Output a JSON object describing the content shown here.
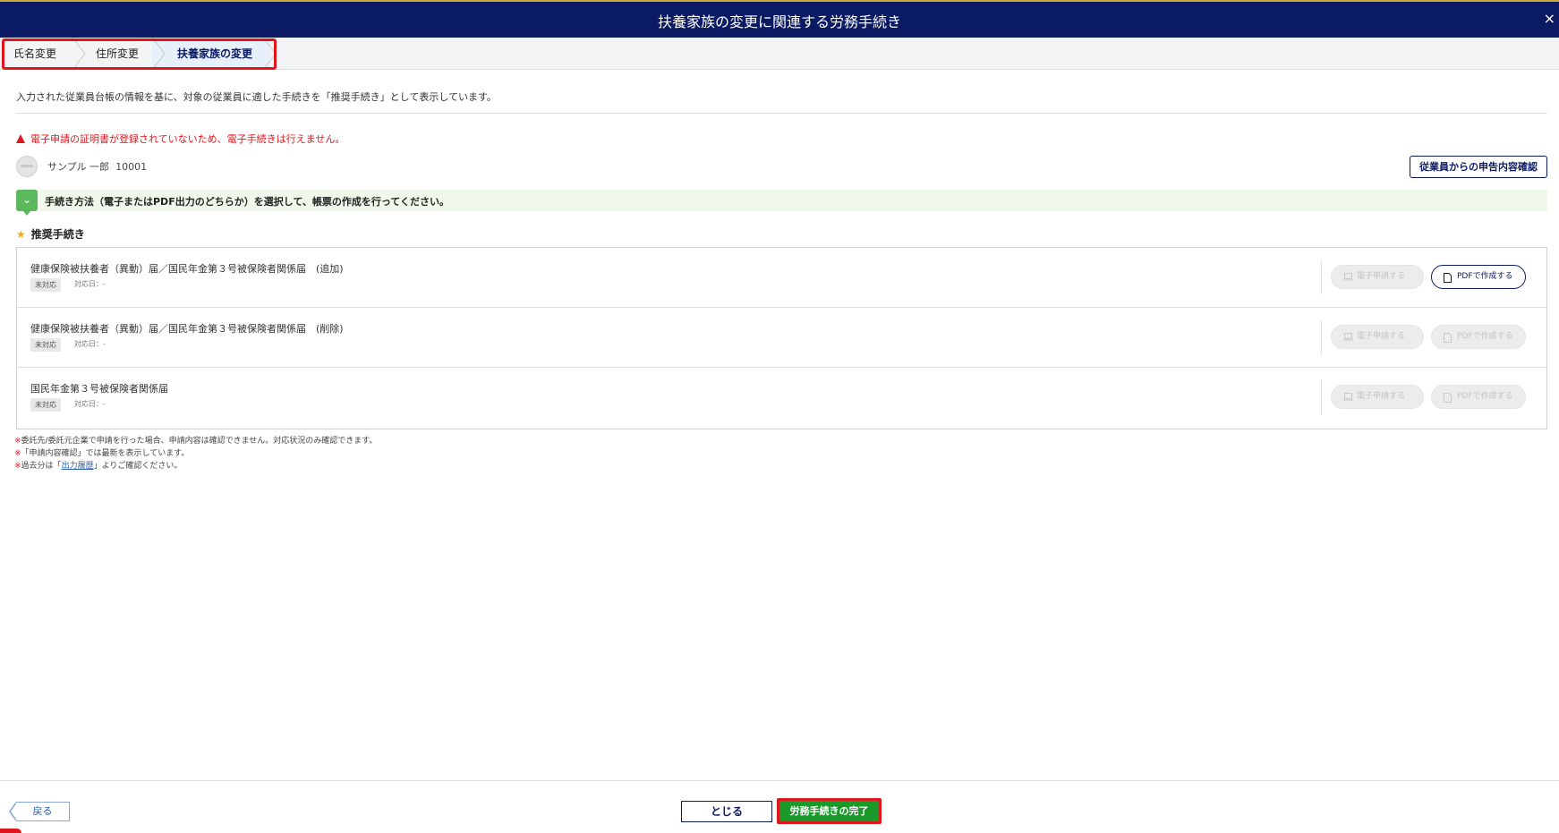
{
  "window": {
    "title": "扶養家族の変更に関連する労務手続き",
    "close": "×"
  },
  "steps": [
    {
      "label": "氏名変更"
    },
    {
      "label": "住所変更"
    },
    {
      "label": "扶養家族の変更"
    }
  ],
  "intro": "入力された従業員台帳の情報を基に、対象の従業員に適した手続きを「推奨手続き」として表示しています。",
  "warning": "電子申請の証明書が登録されていないため、電子手続きは行えません。",
  "employee": {
    "name": "サンプル 一郎",
    "id": "10001"
  },
  "declaration_button": "従業員からの申告内容確認",
  "guide": "手続き方法（電子またはPDF出力のどちらか）を選択して、帳票の作成を行ってください。",
  "recommended_title": "推奨手続き",
  "procedures": [
    {
      "title": "健康保険被扶養者（異動）届／国民年金第３号被保険者関係届　(追加)",
      "status": "未対応",
      "date": "対応日：-",
      "electronic": "電子申請する",
      "pdf": "PDFで作成する"
    },
    {
      "title": "健康保険被扶養者（異動）届／国民年金第３号被保険者関係届　(削除)",
      "status": "未対応",
      "date": "対応日：-",
      "electronic": "電子申請する",
      "pdf": "PDFで作成する"
    },
    {
      "title": "国民年金第３号被保険者関係届",
      "status": "未対応",
      "date": "対応日：-",
      "electronic": "電子申請する",
      "pdf": "PDFで作成する"
    }
  ],
  "notes": {
    "mark": "※",
    "line1": "委託先/委託元企業で申請を行った場合、申請内容は確認できません。対応状況のみ確認できます。",
    "line2": "「申請内容確認」では最新を表示しています。",
    "line3_before": "過去分は「",
    "line3_link": "出力履歴",
    "line3_after": "」よりご確認ください。"
  },
  "footer": {
    "back": "戻る",
    "close": "とじる",
    "complete": "労務手続きの完了"
  },
  "colors": {
    "navy": "#0a1a63",
    "alert_red": "#e0161f",
    "green": "#1a9a2a"
  }
}
